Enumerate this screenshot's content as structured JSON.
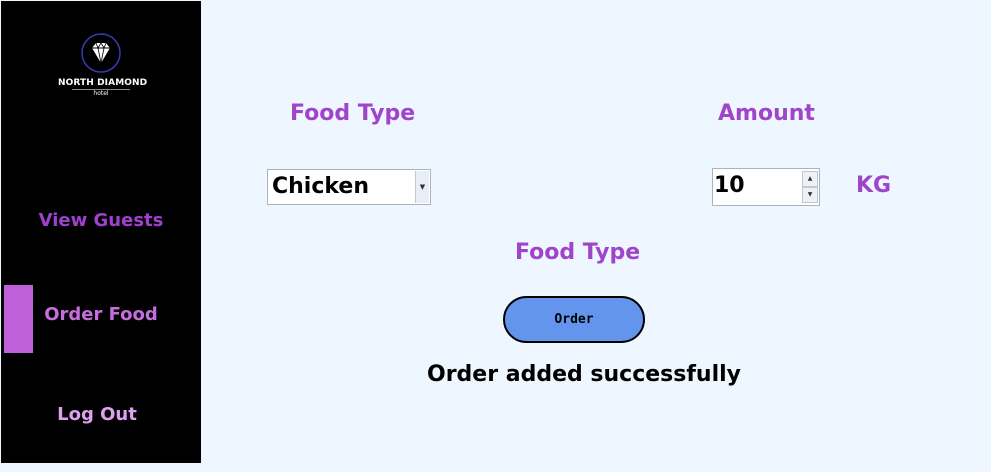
{
  "sidebar": {
    "logo": {
      "name": "NORTH DIAMOND",
      "sub": "hotel",
      "icon": "diamond-icon"
    },
    "items": [
      {
        "label": "View Guests",
        "active": false
      },
      {
        "label": "Order Food",
        "active": true
      },
      {
        "label": "Log Out",
        "active": false
      }
    ],
    "active_color": "#c060d8"
  },
  "main": {
    "food_type_label": "Food Type",
    "food_type_value": "Chicken",
    "amount_label": "Amount",
    "amount_value": "10",
    "unit": "KG",
    "food_type_label_2": "Food Type",
    "order_button": "Order",
    "status_message": "Order added successfully"
  },
  "colors": {
    "background": "#eef6ff",
    "sidebar": "#000000",
    "label": "#a044cc",
    "button": "#6495ed"
  }
}
